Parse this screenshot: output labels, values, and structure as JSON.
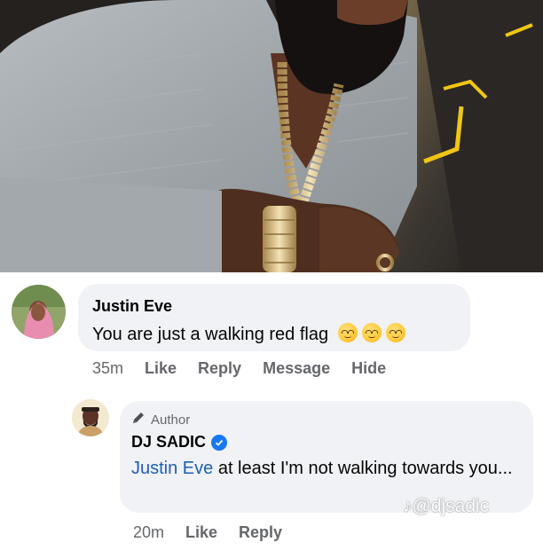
{
  "comment": {
    "author": "Justin Eve",
    "text": "You are just a walking red flag",
    "emoji_icon": "woozy-face-emoji",
    "emoji_count": 3,
    "time": "35m",
    "actions": [
      "Like",
      "Reply",
      "Message",
      "Hide"
    ]
  },
  "reply": {
    "badge": "Author",
    "author": "DJ SADIC",
    "verified": true,
    "mention": "Justin Eve",
    "text": " at least I'm not walking towards you...",
    "time": "20m",
    "actions": [
      "Like",
      "Reply"
    ]
  },
  "watermark": {
    "icon": "tiktok-icon",
    "handle": "@djsadic"
  },
  "colors": {
    "bubble": "#f0f2f5",
    "meta_text": "#65676b",
    "mention": "#1d5fb4",
    "verified_badge": "#1877f2"
  }
}
